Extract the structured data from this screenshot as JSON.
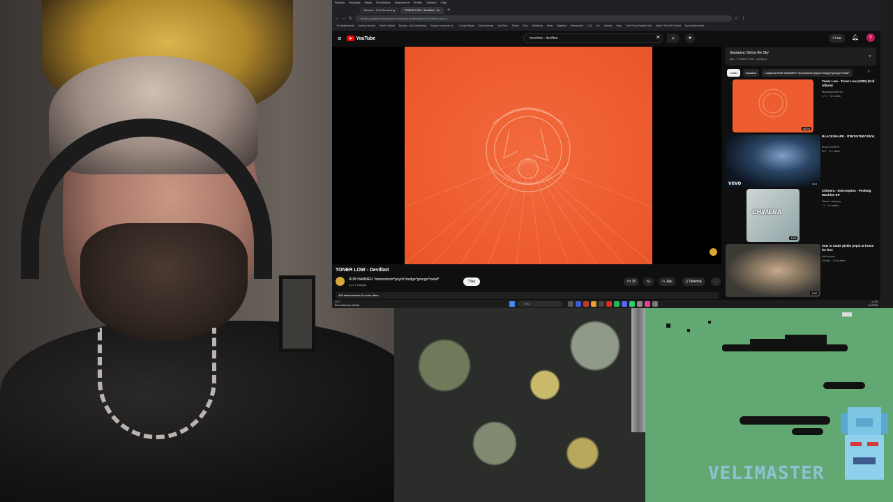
{
  "browser": {
    "menu": [
      "Tiedosto",
      "Muokkaa",
      "Näytä",
      "Sivuhistoria",
      "Kirjanmerkit",
      "Profiilit",
      "Työkalut",
      "Ohje"
    ],
    "tabs": [
      {
        "label": "Browse - Kick Streaming",
        "active": false
      },
      {
        "label": "TONER LOW - Devilbot - Yo",
        "active": true
      }
    ],
    "new_tab": "+",
    "url": "music.youtube.com/watch?v=tonerlow-devilbot&list=RD&start_radio=1",
    "bookmarks": [
      "Tuo kirjanmerkit",
      "Getting Started",
      "PayPal Wallet",
      "Browse - Kick Streaming",
      "Support unknown m...",
      "Google Maps",
      "Oba Webmail",
      "YouTube",
      "Twitch",
      "Kick",
      "Rainbows",
      "Bahu",
      "Nightbot",
      "Streamlabs",
      "C64",
      "Vic",
      "Games",
      "Vinyl",
      "One Piece English Sub",
      "Watch The Wild Robot",
      "Muut kirjanmerkit"
    ]
  },
  "youtube": {
    "logo": "YouTube",
    "search_value": "tonerlow - devilbot",
    "create_label": "+ Luo",
    "avatar_letter": "V"
  },
  "video": {
    "title": "TONER LOW - Devilbot",
    "channel": "ROB HAMMER *stonerdoom*psych*sludge*grunge*metal*",
    "subscribers": "4,67 t. tilaajaa",
    "subscribe_label": "Tilaa",
    "likes": "15",
    "share_label": "Jaa",
    "save_label": "Tallenna",
    "more_label": "...",
    "views": "498 katselukertaa  8 vuotta sitten"
  },
  "mix": {
    "title": "Seuraava: Below the Sky",
    "subtitle": "Mix – TONER LOW - Devilbot"
  },
  "chips": [
    "Kaikki",
    "Haustasi",
    "Lataamat ROB HAMMER *stonerdoom*psych*sludge*grunge*metal*"
  ],
  "recommendations": [
    {
      "title": "Toner Low - Toner Low (2005) (Full Album)",
      "channel": "MonkeyDoldemon",
      "meta": "2,7 t. · 8 v sitten",
      "duration": "46:34"
    },
    {
      "title": "BLACKSHAPE - ITIMTAITIMYVINYL",
      "channel": "BLACKSHAPE",
      "meta": "62 t. · 3 v sitten",
      "duration": "9:15",
      "badge": "vevo"
    },
    {
      "title": "Chimera - Interception - Pecking Machine EP",
      "channel": "Tarkner Autopsy",
      "meta": "7 t. · 5 v sitten",
      "duration": "7:18",
      "thumb_text": "CHIMERA"
    },
    {
      "title": "how to make pickle pepsi at home for free",
      "channel": "VeliJuumat",
      "meta": "19 milj. · 12 kk sitten",
      "duration": "4:58"
    }
  ],
  "taskbar": {
    "weather_temp": "12°C",
    "weather_desc": "Enimmäkseen pilvistä",
    "search_placeholder": "Etsi",
    "time": "17:29",
    "date": "1.8.2025"
  },
  "overlay": {
    "brand": "VELIMASTER"
  },
  "colors": {
    "youtube_red": "#ff0000",
    "album_orange": "#ee5d30",
    "game_green": "#62a873",
    "brand_blue": "#8ec2d2"
  }
}
